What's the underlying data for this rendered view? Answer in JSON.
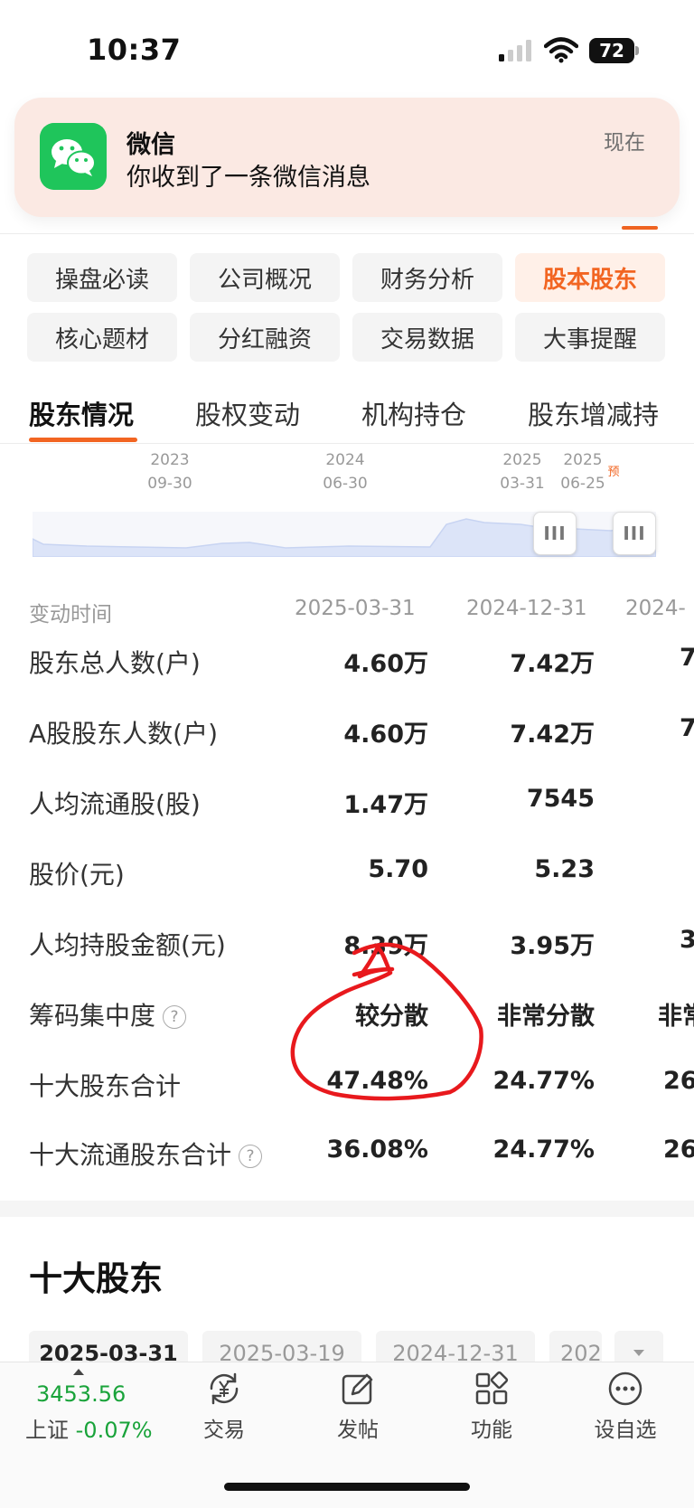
{
  "status_bar": {
    "time": "10:37",
    "battery": "72"
  },
  "notification": {
    "app": "微信",
    "message": "你收到了一条微信消息",
    "time": "现在"
  },
  "feature_grid": [
    {
      "label": "操盘必读",
      "active": false
    },
    {
      "label": "公司概况",
      "active": false
    },
    {
      "label": "财务分析",
      "active": false
    },
    {
      "label": "股本股东",
      "active": true
    },
    {
      "label": "核心题材",
      "active": false
    },
    {
      "label": "分红融资",
      "active": false
    },
    {
      "label": "交易数据",
      "active": false
    },
    {
      "label": "大事提醒",
      "active": false
    }
  ],
  "sub_tabs": [
    "股东情况",
    "股权变动",
    "机构持仓",
    "股东增减持"
  ],
  "timeline": {
    "ticks": [
      {
        "year": "2023",
        "date": "09-30"
      },
      {
        "year": "2024",
        "date": "06-30"
      },
      {
        "year": "2025",
        "date": "03-31"
      },
      {
        "year": "2025",
        "date": "06-25",
        "note": "预"
      }
    ],
    "handle_glyph": "III"
  },
  "table": {
    "header_label": "变动时间",
    "columns": [
      "2025-03-31",
      "2024-12-31",
      "2024-"
    ],
    "rows": [
      {
        "label": "股东总人数(户)",
        "values": [
          "4.60万",
          "7.42万",
          "7"
        ]
      },
      {
        "label": "A股股东人数(户)",
        "values": [
          "4.60万",
          "7.42万",
          "7"
        ]
      },
      {
        "label": "人均流通股(股)",
        "values": [
          "1.47万",
          "7545",
          ""
        ]
      },
      {
        "label": "股价(元)",
        "values": [
          "5.70",
          "5.23",
          ""
        ]
      },
      {
        "label": "人均持股金额(元)",
        "values": [
          "8.39万",
          "3.95万",
          "3"
        ]
      },
      {
        "label": "筹码集中度",
        "values": [
          "较分散",
          "非常分散",
          "非常"
        ],
        "help": "?"
      },
      {
        "label": "十大股东合计",
        "values": [
          "47.48%",
          "24.77%",
          "26"
        ]
      },
      {
        "label": "十大流通股东合计",
        "values": [
          "36.08%",
          "24.77%",
          "26"
        ],
        "help": "?"
      }
    ]
  },
  "top_holders": {
    "title": "十大股东",
    "dates": [
      "2025-03-31",
      "2025-03-19",
      "2024-12-31",
      "202"
    ]
  },
  "bottom_nav": {
    "index_value": "3453.56",
    "index_name": "上证",
    "index_change": "-0.07%",
    "items": [
      {
        "label": "交易",
        "icon": "yen-trade-icon"
      },
      {
        "label": "发帖",
        "icon": "edit-icon"
      },
      {
        "label": "功能",
        "icon": "grid-icon"
      },
      {
        "label": "设自选",
        "icon": "more-icon"
      }
    ]
  },
  "colors": {
    "accent": "#f26522",
    "up_green": "#19a33a",
    "annotation": "#e8191d",
    "chart_fill": "#dce4f8"
  }
}
